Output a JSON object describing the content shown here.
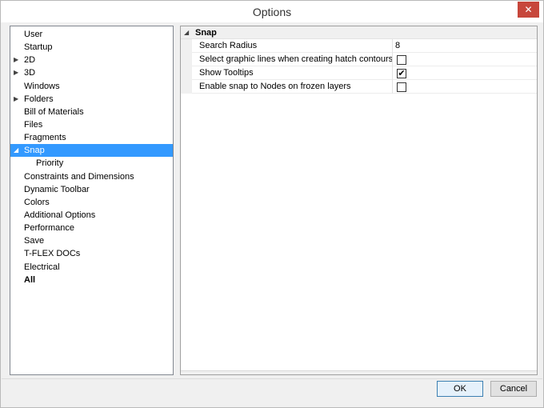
{
  "window": {
    "title": "Options",
    "close_glyph": "✕"
  },
  "tree": {
    "items": [
      {
        "label": "User",
        "expandable": false
      },
      {
        "label": "Startup",
        "expandable": false
      },
      {
        "label": "2D",
        "expandable": true,
        "expanded": false
      },
      {
        "label": "3D",
        "expandable": true,
        "expanded": false
      },
      {
        "label": "Windows",
        "expandable": false
      },
      {
        "label": "Folders",
        "expandable": true,
        "expanded": false
      },
      {
        "label": "Bill of Materials",
        "expandable": false
      },
      {
        "label": "Files",
        "expandable": false
      },
      {
        "label": "Fragments",
        "expandable": false
      },
      {
        "label": "Snap",
        "expandable": true,
        "expanded": true,
        "selected": true
      },
      {
        "label": "Priority",
        "child": true
      },
      {
        "label": "Constraints and Dimensions"
      },
      {
        "label": "Dynamic Toolbar"
      },
      {
        "label": "Colors"
      },
      {
        "label": "Additional Options"
      },
      {
        "label": "Performance"
      },
      {
        "label": "Save"
      },
      {
        "label": "T-FLEX DOCs"
      },
      {
        "label": "Electrical"
      },
      {
        "label": "All",
        "bold": true
      }
    ]
  },
  "properties": {
    "category": "Snap",
    "rows": [
      {
        "name": "Search Radius",
        "value": "8"
      },
      {
        "name": "Select graphic lines when creating hatch contours",
        "checked": false
      },
      {
        "name": "Show Tooltips",
        "checked": true
      },
      {
        "name": "Enable snap to Nodes on frozen layers",
        "checked": false
      }
    ]
  },
  "buttons": {
    "ok": "OK",
    "cancel": "Cancel"
  },
  "glyphs": {
    "check": "✔",
    "collapsed": "▶",
    "expanded": "◢"
  }
}
